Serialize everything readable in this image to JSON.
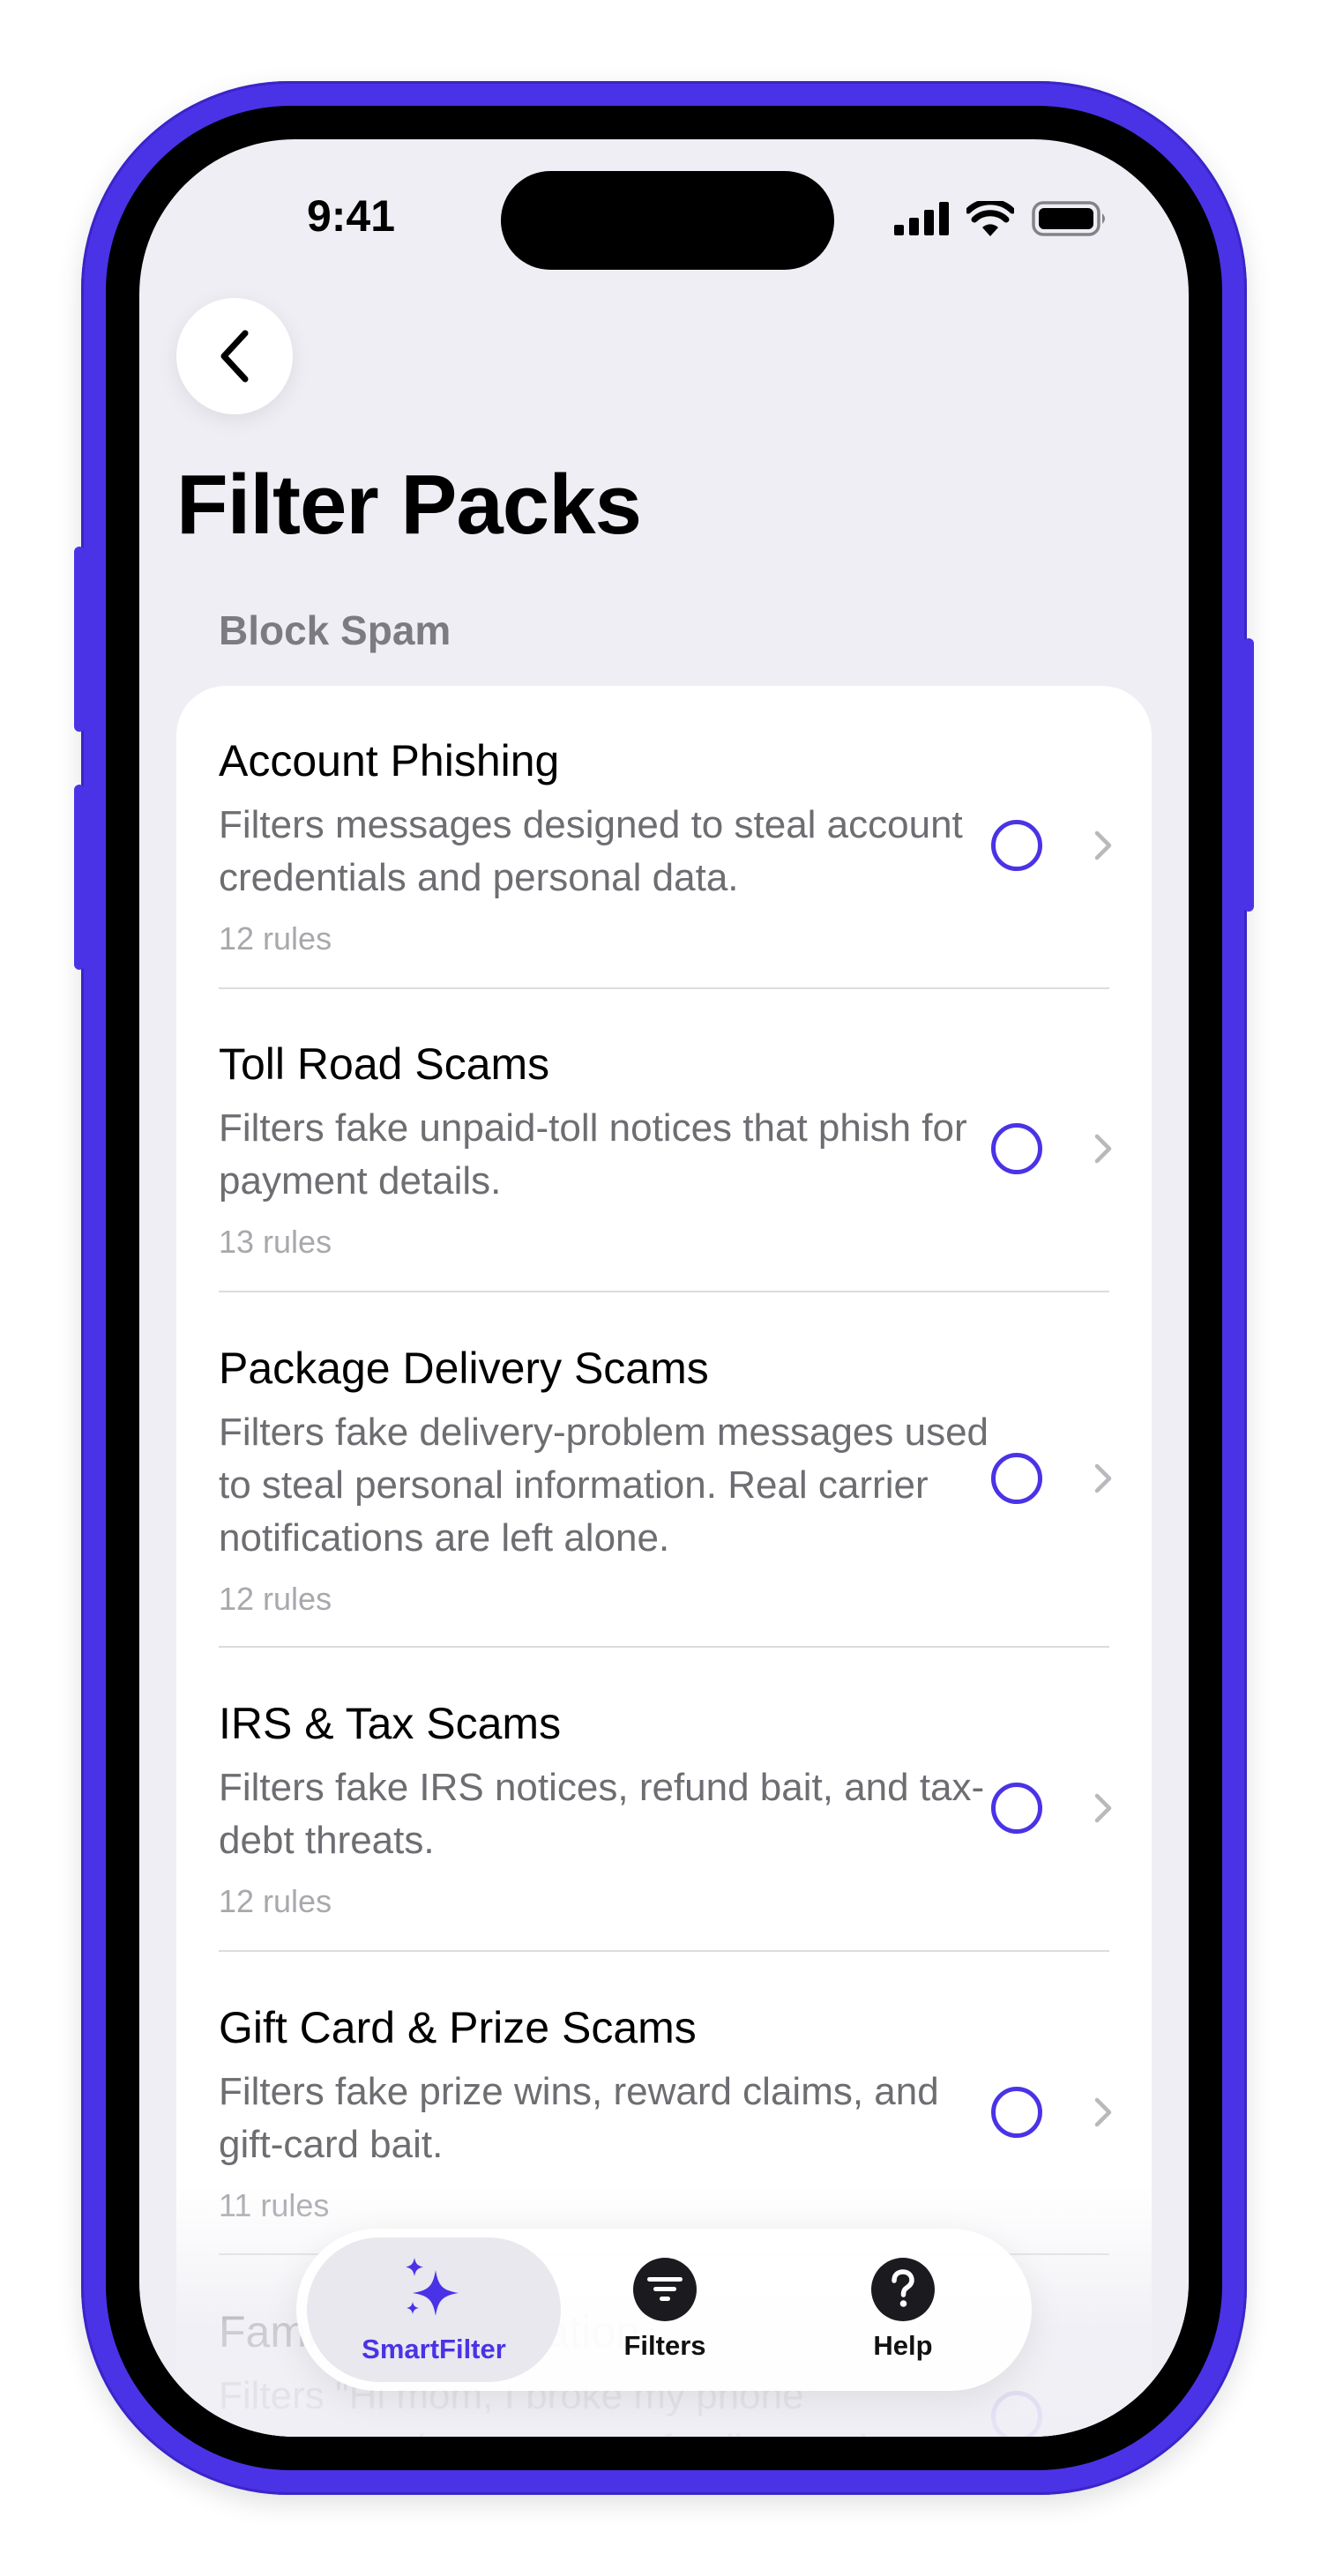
{
  "status_bar": {
    "time": "9:41",
    "icons": [
      "cellular-signal-icon",
      "wifi-icon",
      "battery-icon"
    ]
  },
  "nav": {
    "back_icon": "chevron-left-icon"
  },
  "page": {
    "title": "Filter Packs"
  },
  "section": {
    "header": "Block Spam"
  },
  "packs": [
    {
      "title": "Account Phishing",
      "description": "Filters messages designed to steal account credentials and personal data.",
      "count": "12 rules"
    },
    {
      "title": "Toll Road Scams",
      "description": "Filters fake unpaid-toll notices that phish for payment details.",
      "count": "13 rules"
    },
    {
      "title": "Package Delivery Scams",
      "description": "Filters fake delivery-problem messages used to steal personal information. Real carrier notifications are left alone.",
      "count": "12 rules"
    },
    {
      "title": "IRS & Tax Scams",
      "description": "Filters fake IRS notices, refund bait, and tax-debt threats.",
      "count": "12 rules"
    },
    {
      "title": "Gift Card & Prize Scams",
      "description": "Filters fake prize wins, reward claims, and gift-card bait.",
      "count": "11 rules"
    },
    {
      "title": "Family Impersonation",
      "description": "Filters \"Hi mom, I broke my phone\" messages that pose as a family member",
      "count": ""
    }
  ],
  "tab_bar": {
    "tabs": [
      {
        "label": "SmartFilter",
        "icon": "sparkles-icon",
        "active": true
      },
      {
        "label": "Filters",
        "icon": "filter-icon",
        "active": false
      },
      {
        "label": "Help",
        "icon": "question-mark-icon",
        "active": false
      }
    ]
  },
  "colors": {
    "accent": "#4a33e6",
    "background": "#efeef4",
    "card": "#ffffff",
    "secondary_text": "#6d6d72",
    "tertiary_text": "#a8a8ad"
  }
}
